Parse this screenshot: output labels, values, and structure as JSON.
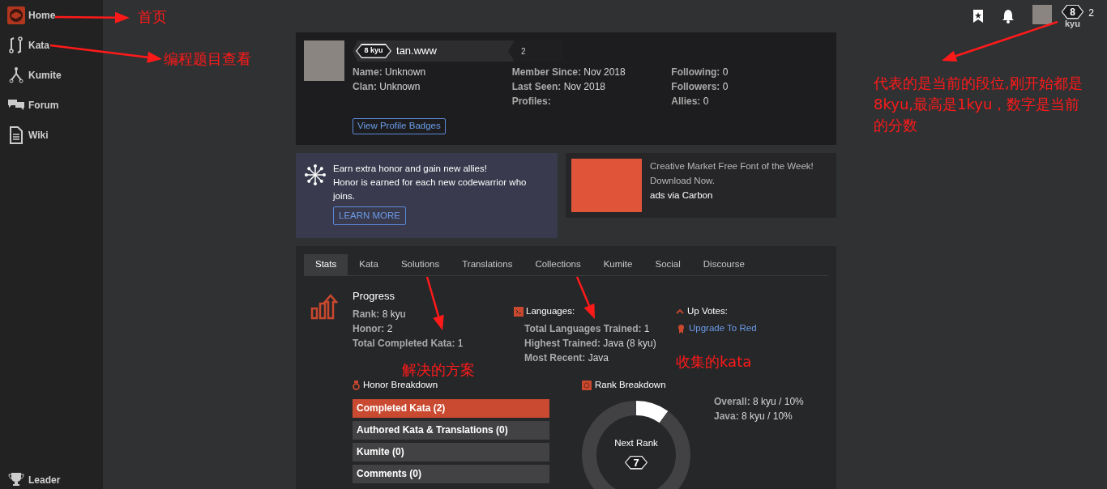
{
  "sidebar": {
    "items": [
      {
        "label": "Home",
        "kind": "logo"
      },
      {
        "label": "Kata",
        "kind": "kata"
      },
      {
        "label": "Kumite",
        "kind": "kumite"
      },
      {
        "label": "Forum",
        "kind": "forum"
      },
      {
        "label": "Wiki",
        "kind": "wiki"
      },
      {
        "label": "Leader",
        "kind": "trophy"
      }
    ]
  },
  "topbar": {
    "rank": "8",
    "rank_unit": "kyu",
    "honor": "2"
  },
  "profile": {
    "rank": "8 kyu",
    "username": "tan.www",
    "honor": "2",
    "columns": [
      [
        {
          "label": "Name:",
          "value": "Unknown"
        },
        {
          "label": "Clan:",
          "value": "Unknown"
        }
      ],
      [
        {
          "label": "Member Since:",
          "value": "Nov 2018"
        },
        {
          "label": "Last Seen:",
          "value": "Nov 2018"
        },
        {
          "label": "Profiles:"
        }
      ],
      [
        {
          "label": "Following:",
          "value": "0"
        },
        {
          "label": "Followers:",
          "value": "0"
        },
        {
          "label": "Allies:",
          "value": "0"
        }
      ]
    ],
    "badges_button": "View Profile Badges"
  },
  "invite": {
    "title": "Earn extra honor and gain new allies!",
    "text": "Honor is earned for each new codewarrior who joins.",
    "button": "LEARN MORE"
  },
  "ad": {
    "text": "Creative Market Free Font of the Week! Download Now.",
    "via": "ads via Carbon"
  },
  "tabs": [
    {
      "label": "Stats",
      "selected": true
    },
    {
      "label": "Kata",
      "selected": false
    },
    {
      "label": "Solutions",
      "selected": false
    },
    {
      "label": "Translations",
      "selected": false
    },
    {
      "label": "Collections",
      "selected": false
    },
    {
      "label": "Kumite",
      "selected": false
    },
    {
      "label": "Social",
      "selected": false
    },
    {
      "label": "Discourse",
      "selected": false
    }
  ],
  "progress": {
    "title": "Progress",
    "rows": [
      {
        "label": "Rank:",
        "value": "8 kyu"
      },
      {
        "label": "Honor:",
        "value": "2"
      },
      {
        "label": "Total Completed Kata:",
        "value": "1"
      }
    ]
  },
  "languages": {
    "title": "Languages:",
    "rows": [
      {
        "label": "Total Languages Trained:",
        "value": "1"
      },
      {
        "label": "Highest Trained:",
        "value": "Java (8 kyu)"
      },
      {
        "label": "Most Recent:",
        "value": "Java"
      }
    ]
  },
  "up_votes": {
    "title": "Up Votes:",
    "link": "Upgrade To Red"
  },
  "honor_breakdown": {
    "title": "Honor Breakdown",
    "items": [
      {
        "label": "Completed Kata (2)",
        "selected": true
      },
      {
        "label": "Authored Kata & Translations (0)",
        "selected": false
      },
      {
        "label": "Kumite (0)",
        "selected": false
      },
      {
        "label": "Comments (0)",
        "selected": false
      }
    ]
  },
  "rank_breakdown": {
    "title": "Rank Breakdown",
    "chart_data": {
      "type": "donut",
      "values": [
        10,
        90
      ]
    },
    "center_label": "Next Rank",
    "next_rank": "7",
    "rows": [
      {
        "label": "Overall:",
        "value": "8 kyu / 10%"
      },
      {
        "label": "Java:",
        "value": "8 kyu / 10%"
      }
    ]
  },
  "annotations": [
    {
      "text": "首页"
    },
    {
      "text": "编程题目查看"
    },
    {
      "text": "解决的方案"
    },
    {
      "text": "收集的kata"
    },
    {
      "text": "代表的是当前的段位,刚开始都是8kyu,最高是1kyu，数字是当前的分数"
    }
  ]
}
